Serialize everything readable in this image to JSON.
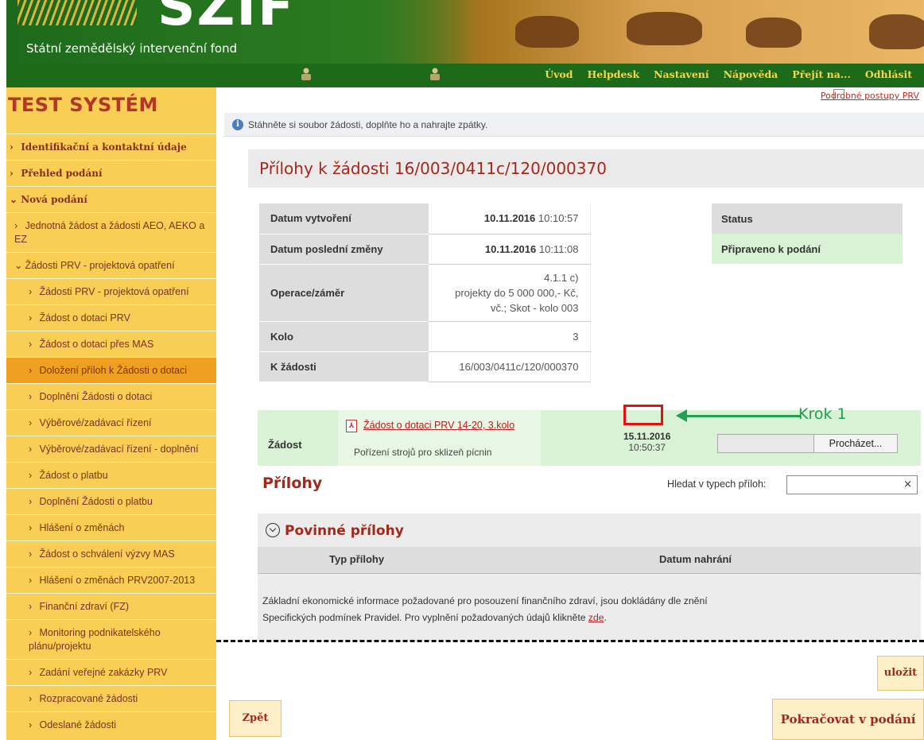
{
  "header": {
    "logo_text": "SZIF",
    "org_name": "Státní zemědělský intervenční fond",
    "nav": [
      "Úvod",
      "Helpdesk",
      "Nastavení",
      "Nápověda",
      "Přejít na...",
      "Odhlásit"
    ]
  },
  "sidebar": {
    "title": "TEST SYSTÉM",
    "items": [
      {
        "label": "Identifikační a kontaktní údaje",
        "chev": "›"
      },
      {
        "label": "Přehled podání",
        "chev": "›"
      },
      {
        "label": "Nová podání",
        "chev": "⌄"
      },
      {
        "label": "Jednotná žádost a žádosti AEO, AEKO a EZ",
        "chev": "›"
      },
      {
        "label": "Žádosti PRV - projektová opatření",
        "chev": "⌄"
      },
      {
        "label": "Žádosti PRV - projektová opatření",
        "chev": "›"
      },
      {
        "label": "Žádost o dotaci PRV",
        "chev": "›"
      },
      {
        "label": "Žádost o dotaci přes MAS",
        "chev": "›"
      },
      {
        "label": "Doložení příloh k Žádosti o dotaci",
        "chev": "›"
      },
      {
        "label": "Doplnění Žádosti o dotaci",
        "chev": "›"
      },
      {
        "label": "Výběrové/zadávací řízení",
        "chev": "›"
      },
      {
        "label": "Výběrové/zadávací řízení - doplnění",
        "chev": "›"
      },
      {
        "label": "Žádost o platbu",
        "chev": "›"
      },
      {
        "label": "Doplnění Žádosti o platbu",
        "chev": "›"
      },
      {
        "label": "Hlášení o změnách",
        "chev": "›"
      },
      {
        "label": "Žádost o schválení výzvy MAS",
        "chev": "›"
      },
      {
        "label": "Hlášení o změnách PRV2007-2013",
        "chev": "›"
      },
      {
        "label": "Finanční zdraví (FZ)",
        "chev": "›"
      },
      {
        "label": "Monitoring podnikatelského plánu/projektu",
        "chev": "›"
      },
      {
        "label": "Zadání veřejné zakázky PRV",
        "chev": "›"
      },
      {
        "label": "Rozpracované žádosti",
        "chev": "›"
      },
      {
        "label": "Odeslané žádosti",
        "chev": "›"
      }
    ]
  },
  "main": {
    "top_link": "Podrobné postupy PRV",
    "info_message": "Stáhněte si soubor žádosti, doplňte ho a nahrajte zpátky.",
    "title": "Přílohy k žádosti 16/003/0411c/120/000370",
    "details": [
      {
        "key": "Datum vytvoření",
        "date": "10.11.2016",
        "time": "10:10:57"
      },
      {
        "key": "Datum poslední změny",
        "date": "10.11.2016",
        "time": "10:11:08"
      },
      {
        "key": "Operace/záměr",
        "value_lines": [
          "4.1.1 c)",
          "projekty do 5 000 000,- Kč,",
          "vč.; Skot - kolo 003"
        ]
      },
      {
        "key": "Kolo",
        "value": "3"
      },
      {
        "key": "K žádosti",
        "value": "16/003/0411c/120/000370"
      }
    ],
    "status": {
      "header": "Status",
      "value": "Připraveno k podání"
    },
    "zadost": {
      "label": "Žádost",
      "doc_link": "Žádost o dotaci PRV 14-20, 3.kolo",
      "doc_desc": "Pořízení strojů pro sklizeň pícnin",
      "date": "15.11.2016",
      "time": "10:50:37",
      "browse": "Procházet..."
    },
    "prilohy": {
      "title": "Přílohy",
      "search_label": "Hledat v typech příloh:",
      "search_value": "",
      "clear": "×"
    },
    "povinne": {
      "title": "Povinné přílohy",
      "col_typ": "Typ přílohy",
      "col_datum": "Datum nahrání",
      "text_1": "Základní ekonomické informace požadované pro posouzení finančního zdraví, jsou dokládány dle znění",
      "text_2": "Specifických podmínek Pravidel. Pro vyplnění požadovaných údajů klikněte",
      "link": "zde",
      "text_end": "."
    },
    "annotation": "Krok 1",
    "buttons": {
      "save": "uložit",
      "back": "Zpět",
      "continue": "Pokračovat v podání"
    }
  },
  "colors": {
    "brand_green": "#1c6a1a",
    "brand_yellow": "#f4c638",
    "accent_red": "#a3281c",
    "annotation_green": "#20a050",
    "highlight_red": "#e31010"
  }
}
